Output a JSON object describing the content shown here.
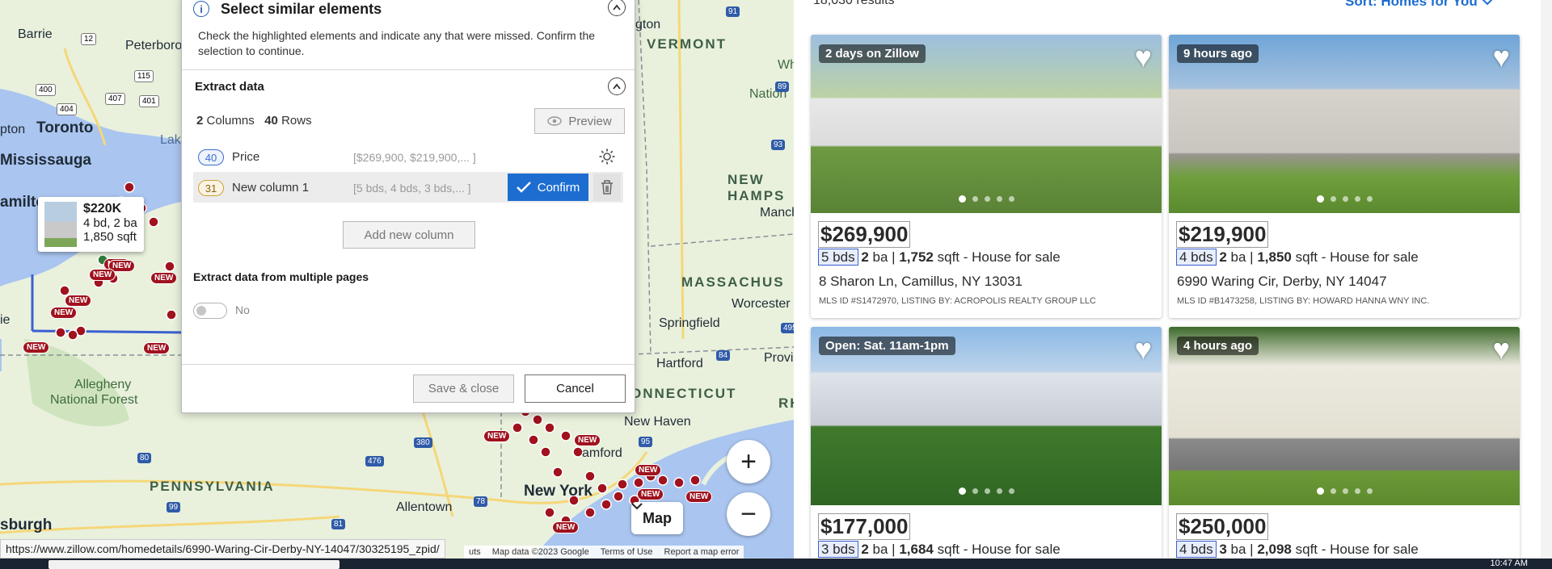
{
  "map": {
    "state_labels": [
      "VERMONT",
      "NEW HAMPS",
      "MASSACHUS",
      "ONNECTICUT",
      "PENNSYLVANIA",
      "RH"
    ],
    "cities": [
      "Barrie",
      "Peterboro",
      "Toronto",
      "Mississauga",
      "amilto",
      "pton",
      "ie",
      "Allegheny",
      "National Forest",
      "Springfield",
      "Worcester",
      "Provi",
      "Hartford",
      "Manch",
      "New Haven",
      "amford",
      "New York",
      "Allentown",
      "sburgh",
      "gton",
      "Wh",
      "Nation"
    ],
    "lake_label": "Lak",
    "highway_shields": [
      "12",
      "115",
      "400",
      "404",
      "407",
      "401",
      "93",
      "91",
      "89",
      "84",
      "95",
      "380",
      "476",
      "78",
      "80",
      "99",
      "81",
      "495"
    ],
    "new_pin_label": "NEW",
    "mini_card": {
      "price": "$220K",
      "beds_baths": "4 bd, 2 ba",
      "sqft": "1,850 sqft"
    },
    "zoom_in": "+",
    "zoom_out": "−",
    "map_type": "Map",
    "footer": [
      "uts",
      "Map data ©2023 Google",
      "Terms of Use",
      "Report a map error"
    ]
  },
  "dialog": {
    "title": "Select similar elements",
    "instructions": "Check the highlighted elements and indicate any that were missed. Confirm the selection to continue.",
    "extract_title": "Extract data",
    "columns_count": "2",
    "columns_label": "Columns",
    "rows_count": "40",
    "rows_label": "Rows",
    "preview_label": "Preview",
    "columns": [
      {
        "count": "40",
        "name": "Price",
        "preview": "[$269,900, $219,900,... ]"
      },
      {
        "count": "31",
        "name": "New column 1",
        "preview": "[5 bds, 4 bds, 3 bds,... ]"
      }
    ],
    "confirm_label": "Confirm",
    "add_column_label": "Add new column",
    "multi_page_title": "Extract data from multiple pages",
    "toggle_label": "No",
    "save_close_label": "Save & close",
    "cancel_label": "Cancel"
  },
  "listings": {
    "results": "18,030 results",
    "sort": "Sort: Homes for You",
    "cards": [
      {
        "tag": "2 days on Zillow",
        "price": "$269,900",
        "beds": "5 bds",
        "baths": "2",
        "baths_label": "ba",
        "sqft": "1,752",
        "sqft_label": "sqft",
        "type": "House for sale",
        "address": "8 Sharon Ln, Camillus, NY 13031",
        "mls": "MLS ID #S1472970, LISTING BY: ACROPOLIS REALTY GROUP LLC"
      },
      {
        "tag": "9 hours ago",
        "price": "$219,900",
        "beds": "4 bds",
        "baths": "2",
        "baths_label": "ba",
        "sqft": "1,850",
        "sqft_label": "sqft",
        "type": "House for sale",
        "address": "6990 Waring Cir, Derby, NY 14047",
        "mls": "MLS ID #B1473258, LISTING BY: HOWARD HANNA WNY INC."
      },
      {
        "tag": "Open: Sat. 11am-1pm",
        "price": "$177,000",
        "beds": "3 bds",
        "baths": "2",
        "baths_label": "ba",
        "sqft": "1,684",
        "sqft_label": "sqft",
        "type": "House for sale",
        "address": "",
        "mls": ""
      },
      {
        "tag": "4 hours ago",
        "price": "$250,000",
        "beds": "4 bds",
        "baths": "3",
        "baths_label": "ba",
        "sqft": "2,098",
        "sqft_label": "sqft",
        "type": "House for sale",
        "address": "",
        "mls": ""
      }
    ]
  },
  "status_url": "https://www.zillow.com/homedetails/6990-Waring-Cir-Derby-NY-14047/30325195_zpid/",
  "taskbar": {
    "clock": "10:47 AM"
  },
  "colors": {
    "accent": "#1d6dd1",
    "pin": "#a0121e",
    "map_bg": "#e9f1dd",
    "water": "#aac5f0"
  }
}
